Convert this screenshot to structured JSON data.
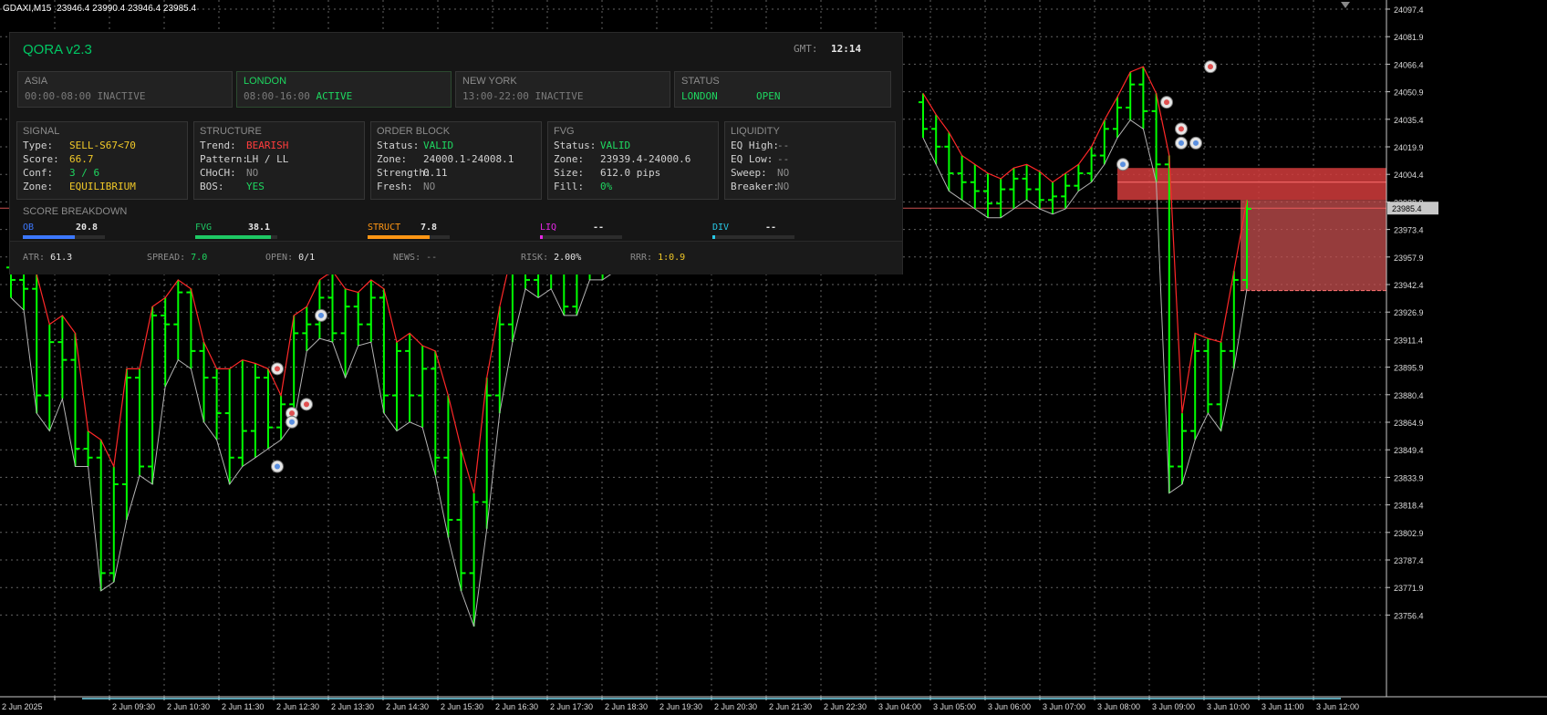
{
  "window_title": {
    "symbol": "GDAXI,M15",
    "ohlc": "23946.4 23990.4 23946.4 23985.4"
  },
  "panel": {
    "title": "QORA v2.3",
    "gmt_label": "GMT:",
    "gmt_time": "12:14",
    "sessions": [
      {
        "name": "ASIA",
        "time": "00:00-08:00",
        "status": "INACTIVE",
        "active": false
      },
      {
        "name": "LONDON",
        "time": "08:00-16:00",
        "status": "ACTIVE",
        "active": true
      },
      {
        "name": "NEW YORK",
        "time": "13:00-22:00",
        "status": "INACTIVE",
        "active": false
      }
    ],
    "status_box": {
      "title": "STATUS",
      "session": "LONDON",
      "state": "OPEN"
    },
    "signal": {
      "title": "SIGNAL",
      "type_label": "Type:",
      "type_value": "SELL-S67<70",
      "score_label": "Score:",
      "score_value": "66.7",
      "conf_label": "Conf:",
      "conf_value": "3 / 6",
      "zone_label": "Zone:",
      "zone_value": "EQUILIBRIUM"
    },
    "structure": {
      "title": "STRUCTURE",
      "trend_label": "Trend:",
      "trend_value": "BEARISH",
      "pattern_label": "Pattern:",
      "pattern_value": "LH / LL",
      "choch_label": "CHoCH:",
      "choch_value": "NO",
      "bos_label": "BOS:",
      "bos_value": "YES"
    },
    "order_block": {
      "title": "ORDER BLOCK",
      "status_label": "Status:",
      "status_value": "VALID",
      "zone_label": "Zone:",
      "zone_value": "24000.1-24008.1",
      "strength_label": "Strength:",
      "strength_value": "0.11",
      "fresh_label": "Fresh:",
      "fresh_value": "NO"
    },
    "fvg": {
      "title": "FVG",
      "status_label": "Status:",
      "status_value": "VALID",
      "zone_label": "Zone:",
      "zone_value": "23939.4-24000.6",
      "size_label": "Size:",
      "size_value": "612.0 pips",
      "fill_label": "Fill:",
      "fill_value": "0%"
    },
    "liquidity": {
      "title": "LIQUIDITY",
      "eqh_label": "EQ High:",
      "eqh_value": "--",
      "eql_label": "EQ Low:",
      "eql_value": "--",
      "sweep_label": "Sweep:",
      "sweep_value": "NO",
      "breaker_label": "Breaker:",
      "breaker_value": "NO"
    },
    "score_breakdown": {
      "title": "SCORE BREAKDOWN",
      "items": [
        {
          "label": "OB",
          "value": "20.8",
          "fraction": 0.63,
          "color": "#3c78ff"
        },
        {
          "label": "FVG",
          "value": "38.1",
          "fraction": 0.92,
          "color": "#1ec864"
        },
        {
          "label": "STRUCT",
          "value": "7.8",
          "fraction": 0.76,
          "color": "#ff9614"
        },
        {
          "label": "LIQ",
          "value": "--",
          "fraction": 0.03,
          "color": "#e628e6"
        },
        {
          "label": "DIV",
          "value": "--",
          "fraction": 0.03,
          "color": "#28c8e6"
        }
      ]
    },
    "footer": {
      "atr_label": "ATR:",
      "atr_value": "61.3",
      "spread_label": "SPREAD:",
      "spread_value": "7.0",
      "open_label": "OPEN:",
      "open_value": "0/1",
      "news_label": "NEWS:",
      "news_value": "--",
      "risk_label": "RISK:",
      "risk_value": "2.00%",
      "rrr_label": "RRR:",
      "rrr_value": "1:0.9"
    }
  },
  "colors": {
    "bar": "#00ff00",
    "upper_band": "#ff2828",
    "lower_band": "#b4b4b4",
    "zone_ob": "#d23c3c",
    "zone_fvg": "#c85050",
    "grid": "#b4b4b4",
    "current_price_tag": "#c8c8c8",
    "price_line": "#ff6464"
  },
  "chart_data": {
    "type": "ohlc",
    "symbol": "GDAXI",
    "timeframe": "M15",
    "y_ticks": [
      "24097.4",
      "24081.9",
      "24066.4",
      "24050.9",
      "24035.4",
      "24019.9",
      "24004.4",
      "23988.9",
      "23973.4",
      "23957.9",
      "23942.4",
      "23926.9",
      "23911.4",
      "23895.9",
      "23880.4",
      "23864.9",
      "23849.4",
      "23833.9",
      "23818.4",
      "23802.9",
      "23787.4",
      "23771.9",
      "23756.4"
    ],
    "y_range": [
      23745,
      24100
    ],
    "current_price": "23985.4",
    "price_line": 23985.4,
    "x_ticks": [
      "2 Jun 2025",
      "2 Jun 09:30",
      "2 Jun 10:30",
      "2 Jun 11:30",
      "2 Jun 12:30",
      "2 Jun 13:30",
      "2 Jun 14:30",
      "2 Jun 15:30",
      "2 Jun 16:30",
      "2 Jun 17:30",
      "2 Jun 18:30",
      "2 Jun 19:30",
      "2 Jun 20:30",
      "2 Jun 21:30",
      "2 Jun 22:30",
      "3 Jun 04:00",
      "3 Jun 05:00",
      "3 Jun 06:00",
      "3 Jun 07:00",
      "3 Jun 08:00",
      "3 Jun 09:00",
      "3 Jun 10:00",
      "3 Jun 11:00",
      "3 Jun 12:00"
    ],
    "bars": [
      [
        23952,
        23958,
        23935,
        23945
      ],
      [
        23945,
        23960,
        23928,
        23940
      ],
      [
        23940,
        23948,
        23870,
        23880
      ],
      [
        23880,
        23920,
        23860,
        23910
      ],
      [
        23910,
        23925,
        23878,
        23900
      ],
      [
        23900,
        23915,
        23840,
        23850
      ],
      [
        23850,
        23860,
        23840,
        23845
      ],
      [
        23845,
        23855,
        23770,
        23780
      ],
      [
        23780,
        23840,
        23775,
        23830
      ],
      [
        23830,
        23895,
        23810,
        23890
      ],
      [
        23890,
        23895,
        23835,
        23840
      ],
      [
        23840,
        23930,
        23830,
        23925
      ],
      [
        23925,
        23935,
        23885,
        23920
      ],
      [
        23920,
        23945,
        23900,
        23938
      ],
      [
        23938,
        23940,
        23895,
        23905
      ],
      [
        23905,
        23910,
        23865,
        23890
      ],
      [
        23890,
        23895,
        23855,
        23870
      ],
      [
        23870,
        23895,
        23830,
        23845
      ],
      [
        23845,
        23900,
        23840,
        23860
      ],
      [
        23860,
        23898,
        23845,
        23890
      ],
      [
        23890,
        23895,
        23850,
        23862
      ],
      [
        23862,
        23880,
        23855,
        23875
      ],
      [
        23875,
        23925,
        23865,
        23915
      ],
      [
        23915,
        23930,
        23905,
        23920
      ],
      [
        23920,
        23945,
        23912,
        23935
      ],
      [
        23935,
        23950,
        23910,
        23915
      ],
      [
        23915,
        23940,
        23890,
        23930
      ],
      [
        23930,
        23938,
        23908,
        23920
      ],
      [
        23920,
        23945,
        23910,
        23935
      ],
      [
        23935,
        23940,
        23870,
        23880
      ],
      [
        23880,
        23910,
        23860,
        23905
      ],
      [
        23905,
        23915,
        23865,
        23880
      ],
      [
        23880,
        23908,
        23862,
        23895
      ],
      [
        23895,
        23905,
        23835,
        23845
      ],
      [
        23845,
        23880,
        23800,
        23810
      ],
      [
        23810,
        23850,
        23770,
        23780
      ],
      [
        23780,
        23825,
        23750,
        23820
      ],
      [
        23820,
        23890,
        23805,
        23880
      ],
      [
        23880,
        23930,
        23870,
        23920
      ],
      [
        23920,
        23962,
        23910,
        23955
      ],
      [
        23955,
        23965,
        23940,
        23945
      ],
      [
        23945,
        23962,
        23935,
        23950
      ],
      [
        23950,
        23968,
        23940,
        23960
      ],
      [
        23960,
        23965,
        23925,
        23930
      ],
      [
        23930,
        23965,
        23925,
        23958
      ],
      [
        23958,
        23962,
        23945,
        23950
      ],
      [
        23950,
        23965,
        23945,
        23960
      ],
      [
        23960,
        23970,
        23950,
        23962
      ],
      [
        23962,
        23975,
        23955,
        23968
      ],
      [
        23968,
        23975,
        23955,
        23970
      ]
    ],
    "bars_right": [
      [
        24045,
        24050,
        24025,
        24030
      ],
      [
        24030,
        24038,
        24010,
        24020
      ],
      [
        24020,
        24028,
        23995,
        24005
      ],
      [
        24005,
        24015,
        23990,
        24000
      ],
      [
        24000,
        24010,
        23985,
        23995
      ],
      [
        23995,
        24005,
        23980,
        23988
      ],
      [
        23988,
        24002,
        23980,
        23996
      ],
      [
        23996,
        24008,
        23985,
        24002
      ],
      [
        24002,
        24010,
        23990,
        23996
      ],
      [
        23996,
        24006,
        23985,
        23990
      ],
      [
        23990,
        24000,
        23982,
        23992
      ],
      [
        23992,
        24005,
        23985,
        23998
      ],
      [
        23998,
        24010,
        23995,
        24005
      ],
      [
        24005,
        24020,
        24000,
        24015
      ],
      [
        24015,
        24035,
        24010,
        24030
      ],
      [
        24030,
        24048,
        24025,
        24042
      ],
      [
        24042,
        24062,
        24035,
        24055
      ],
      [
        24055,
        24065,
        24030,
        24040
      ],
      [
        24040,
        24050,
        24000,
        24010
      ],
      [
        24010,
        24015,
        23825,
        23840
      ],
      [
        23840,
        23870,
        23830,
        23860
      ],
      [
        23860,
        23915,
        23855,
        23905
      ],
      [
        23905,
        23912,
        23870,
        23875
      ],
      [
        23875,
        23910,
        23860,
        23905
      ],
      [
        23905,
        23950,
        23895,
        23945
      ],
      [
        23945,
        23990,
        23940,
        23985
      ]
    ]
  }
}
